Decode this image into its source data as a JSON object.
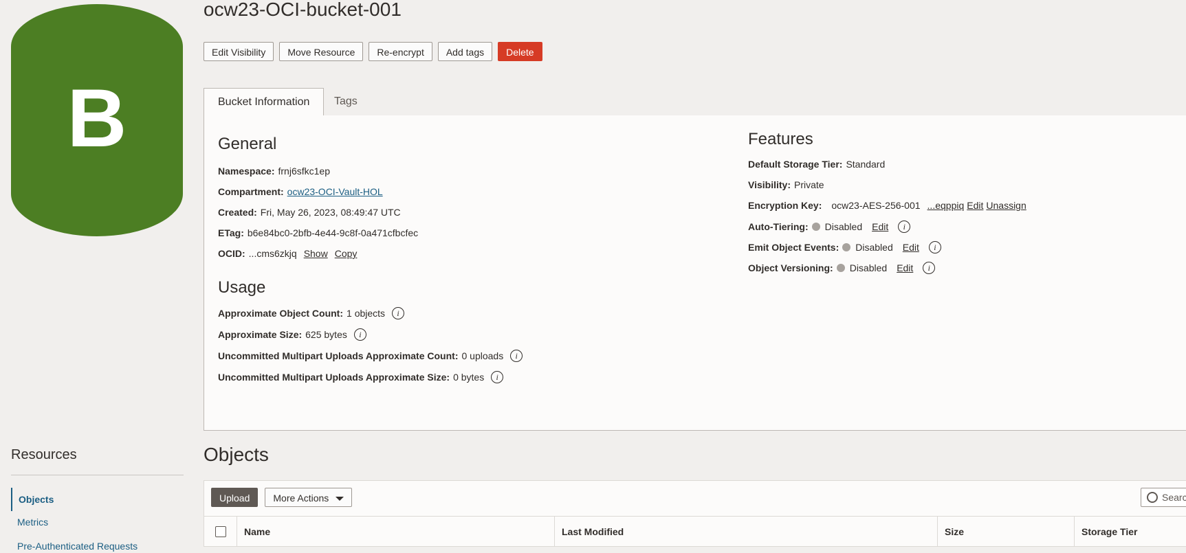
{
  "bucket_icon": {
    "letter": "B",
    "color": "#4c7e23"
  },
  "page_title": "ocw23-OCI-bucket-001",
  "toolbar": {
    "edit_visibility": "Edit Visibility",
    "move_resource": "Move Resource",
    "re_encrypt": "Re-encrypt",
    "add_tags": "Add tags",
    "delete": "Delete"
  },
  "tabs": {
    "bucket_information": "Bucket Information",
    "tags": "Tags"
  },
  "general": {
    "title": "General",
    "namespace_label": "Namespace:",
    "namespace": "frnj6sfkc1ep",
    "compartment_label": "Compartment:",
    "compartment": "ocw23-OCI-Vault-HOL",
    "created_label": "Created:",
    "created": "Fri, May 26, 2023, 08:49:47 UTC",
    "etag_label": "ETag:",
    "etag": "b6e84bc0-2bfb-4e44-9c8f-0a471cfbcfec",
    "ocid_label": "OCID:",
    "ocid": "...cms6zkjq",
    "show": "Show",
    "copy": "Copy"
  },
  "usage": {
    "title": "Usage",
    "object_count_label": "Approximate Object Count:",
    "object_count": "1 objects",
    "size_label": "Approximate Size:",
    "size": "625 bytes",
    "multipart_count_label": "Uncommitted Multipart Uploads Approximate Count:",
    "multipart_count": "0 uploads",
    "multipart_size_label": "Uncommitted Multipart Uploads Approximate Size:",
    "multipart_size": "0 bytes"
  },
  "features": {
    "title": "Features",
    "storage_tier_label": "Default Storage Tier:",
    "storage_tier": "Standard",
    "visibility_label": "Visibility:",
    "visibility": "Private",
    "encryption_label": "Encryption Key:",
    "encryption_key": "ocw23-AES-256-001",
    "encryption_key_ocid": "...eqppiq",
    "encryption_edit": "Edit",
    "encryption_unassign": "Unassign",
    "auto_tiering_label": "Auto-Tiering:",
    "auto_tiering": "Disabled",
    "emit_events_label": "Emit Object Events:",
    "emit_events": "Disabled",
    "versioning_label": "Object Versioning:",
    "versioning": "Disabled",
    "edit": "Edit"
  },
  "resources": {
    "title": "Resources",
    "items": [
      "Objects",
      "Metrics",
      "Pre-Authenticated Requests"
    ]
  },
  "objects": {
    "title": "Objects",
    "upload": "Upload",
    "more_actions": "More Actions",
    "search_placeholder": "Search",
    "columns": [
      "Name",
      "Last Modified",
      "Size",
      "Storage Tier"
    ]
  }
}
